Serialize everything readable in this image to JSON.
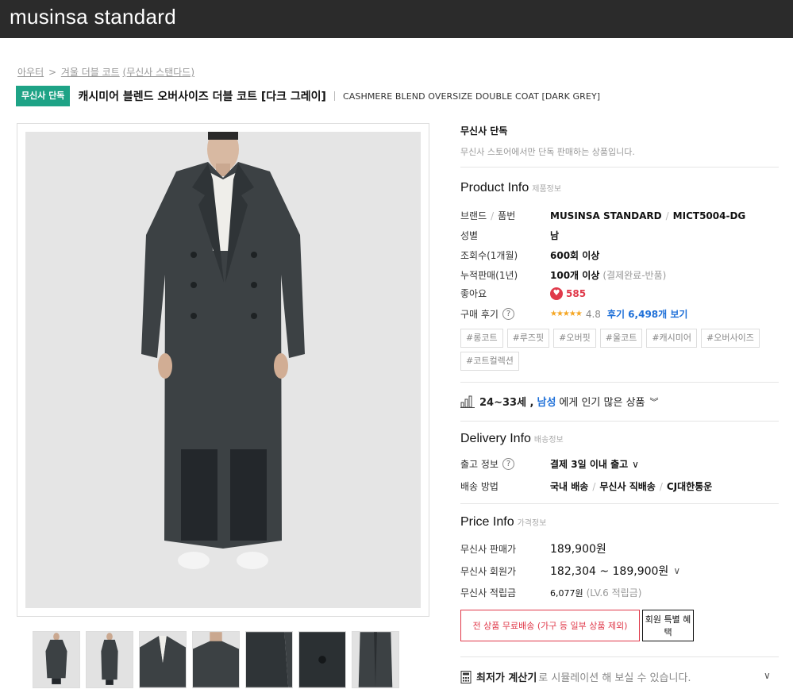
{
  "site": {
    "logo": "musinsa standard"
  },
  "breadcrumb": {
    "level1": "아우터",
    "sep": ">",
    "level2": "겨울 더블 코트",
    "level3": "(무신사 스탠다드)"
  },
  "product": {
    "badge": "무신사 단독",
    "title_ko": "캐시미어 블렌드 오버사이즈 더블 코트 [다크 그레이]",
    "title_en": "CASHMERE BLEND OVERSIZE DOUBLE COAT [DARK GREY]"
  },
  "exclusive": {
    "label": "무신사 단독",
    "sub": "무신사 스토어에서만 단독 판매하는 상품입니다."
  },
  "product_info": {
    "heading": "Product Info",
    "heading_sub": "제품정보",
    "brand_label": "브랜드",
    "sku_label": "품번",
    "brand": "MUSINSA STANDARD",
    "sku": "MICT5004-DG",
    "gender_label": "성별",
    "gender": "남",
    "views_label": "조회수(1개월)",
    "views": "600회 이상",
    "sales_label": "누적판매(1년)",
    "sales": "100개 이상",
    "sales_note": "(결제완료-반품)",
    "likes_label": "좋아요",
    "likes": "585",
    "review_label": "구매 후기",
    "stars": "★★★★★",
    "rating": "4.8",
    "review_link": "후기 6,498개 보기"
  },
  "tags": [
    "#롱코트",
    "#루즈핏",
    "#오버핏",
    "#울코트",
    "#캐시미어",
    "#오버사이즈",
    "#코트컬렉션"
  ],
  "popular": {
    "age": "24~33세 ,",
    "gender": "남성",
    "rest": "에게 인기 많은 상품"
  },
  "delivery_info": {
    "heading": "Delivery Info",
    "heading_sub": "배송정보",
    "ship_label": "출고 정보",
    "ship_value": "결제 3일 이내 출고",
    "method_label": "배송 방법",
    "method_1": "국내 배송",
    "method_2": "무신사 직배송",
    "method_3": "CJ대한통운"
  },
  "price_info": {
    "heading": "Price Info",
    "heading_sub": "가격정보",
    "sale_label": "무신사 판매가",
    "sale": "189,900원",
    "member_label": "무신사 회원가",
    "member": "182,304 ~ 189,900원",
    "points_label": "무신사 적립금",
    "points": "6,077원",
    "points_note": "(LV.6 적립금)"
  },
  "buttons": {
    "free_shipping": "전 상품 무료배송 (가구 등 일부 상품 제외)",
    "member_benefit": "회원 특별 혜택"
  },
  "calculator": {
    "bold": "최저가 계산기",
    "rest": "로 시뮬레이션 해 보실 수 있습니다."
  },
  "colors": {
    "header_bg": "#2b2b2b",
    "badge_green": "#1ea386",
    "accent_red": "#e0394a",
    "link_blue": "#1d6fd8"
  }
}
